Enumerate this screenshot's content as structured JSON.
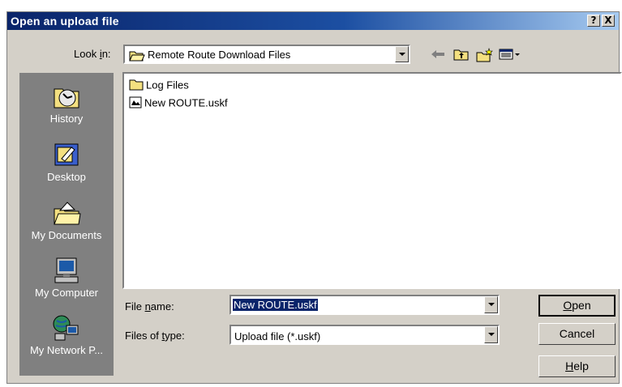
{
  "window": {
    "title": "Open an upload file",
    "help_btn": "?",
    "close_btn": "X"
  },
  "lookin": {
    "label_pre": "Look ",
    "label_accel": "i",
    "label_post": "n:",
    "value": "Remote Route Download Files"
  },
  "places": [
    {
      "label": "History",
      "icon": "history-icon"
    },
    {
      "label": "Desktop",
      "icon": "desktop-icon"
    },
    {
      "label": "My Documents",
      "icon": "my-documents-icon"
    },
    {
      "label": "My Computer",
      "icon": "my-computer-icon"
    },
    {
      "label": "My Network P...",
      "icon": "my-network-places-icon"
    }
  ],
  "files": [
    {
      "name": "Log Files",
      "icon": "folder-icon"
    },
    {
      "name": "New ROUTE.uskf",
      "icon": "file-icon"
    }
  ],
  "filename": {
    "label_pre": "File ",
    "label_accel": "n",
    "label_post": "ame:",
    "value": "New ROUTE.uskf"
  },
  "filetype": {
    "label_pre": "Files of ",
    "label_accel": "t",
    "label_post": "ype:",
    "value": "Upload file (*.uskf)"
  },
  "buttons": {
    "open_accel": "O",
    "open_rest": "pen",
    "cancel": "Cancel",
    "help_accel": "H",
    "help_rest": "elp"
  },
  "colors": {
    "titlebar_start": "#0a246a",
    "titlebar_end": "#a6caf0",
    "dialog_bg": "#d4d0c8",
    "places_bg": "#808080",
    "selection": "#0a246a"
  }
}
